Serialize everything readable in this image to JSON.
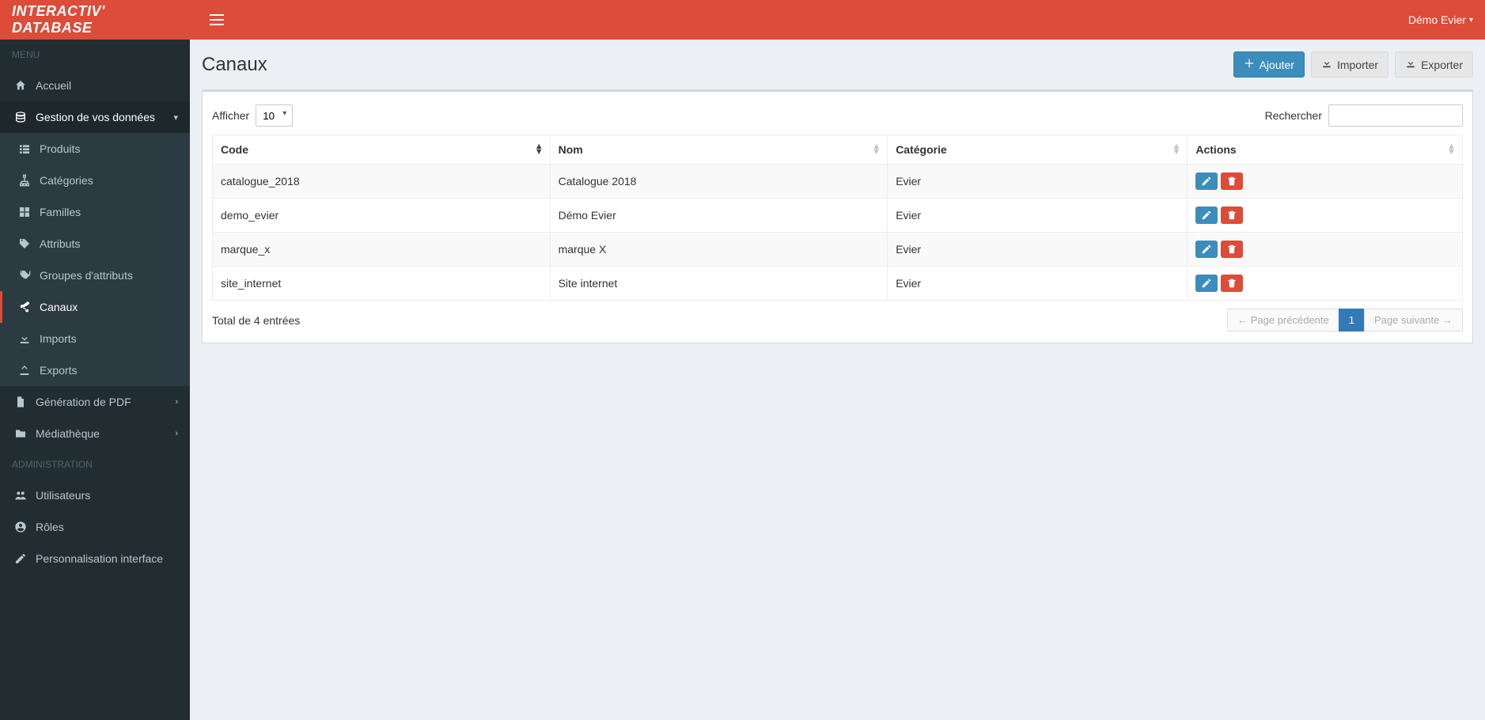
{
  "brand": "INTERACTIV' DATABASE",
  "user": {
    "name": "Démo Evier"
  },
  "sidebar": {
    "sections": {
      "menu_label": "MENU",
      "admin_label": "ADMINISTRATION"
    },
    "items": {
      "accueil": "Accueil",
      "gestion": "Gestion de vos données",
      "produits": "Produits",
      "categories": "Catégories",
      "familles": "Familles",
      "attributs": "Attributs",
      "groupes_attributs": "Groupes d'attributs",
      "canaux": "Canaux",
      "imports": "Imports",
      "exports": "Exports",
      "generation_pdf": "Génération de PDF",
      "mediatheque": "Médiathèque",
      "utilisateurs": "Utilisateurs",
      "roles": "Rôles",
      "personnalisation": "Personnalisation interface"
    }
  },
  "page": {
    "title": "Canaux",
    "actions": {
      "add": "Ajouter",
      "import": "Importer",
      "export": "Exporter"
    }
  },
  "table": {
    "length_label": "Afficher",
    "length_value": "10",
    "search_label": "Rechercher",
    "columns": {
      "code": "Code",
      "nom": "Nom",
      "categorie": "Catégorie",
      "actions": "Actions"
    },
    "rows": [
      {
        "code": "catalogue_2018",
        "nom": "Catalogue 2018",
        "categorie": "Evier"
      },
      {
        "code": "demo_evier",
        "nom": "Démo Evier",
        "categorie": "Evier"
      },
      {
        "code": "marque_x",
        "nom": "marque X",
        "categorie": "Evier"
      },
      {
        "code": "site_internet",
        "nom": "Site internet",
        "categorie": "Evier"
      }
    ],
    "info": "Total de 4 entrées",
    "pagination": {
      "prev": "← Page précédente",
      "next": "Page suivante →",
      "current": "1"
    }
  }
}
